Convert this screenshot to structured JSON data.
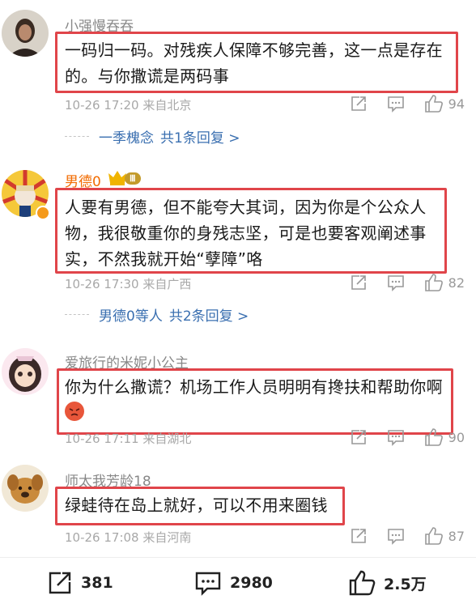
{
  "comments": [
    {
      "username": "小强慢吞吞",
      "text": "一码归一码。对残疾人保障不够完善，这一点是存在的。与你撒谎是两码事",
      "meta": "10-26 17:20 来自北京",
      "likes": "94",
      "reply": {
        "names": "一季槐念",
        "count": "共1条回复 >"
      }
    },
    {
      "username": "男德0",
      "badge": "Ⅲ",
      "text": "人要有男德，但不能夸大其词，因为你是个公众人物，我很敬重你的身残志坚，可是也要客观阐述事实，不然我就开始“孽障”咯",
      "meta": "10-26 17:30 来自广西",
      "likes": "82",
      "reply": {
        "names": "男德0等人",
        "count": "共2条回复 >"
      }
    },
    {
      "username": "爱旅行的米妮小公主",
      "text": "你为什么撒谎？机场工作人员明明有搀扶和帮助你啊",
      "meta": "10-26 17:11 来自湖北",
      "likes": "90"
    },
    {
      "username": "师太我芳龄18",
      "text": "绿蛙待在岛上就好，可以不用来圈钱",
      "meta": "10-26 17:08 来自河南",
      "likes": "87"
    }
  ],
  "bottom_bar": {
    "shares": "381",
    "comments": "2980",
    "likes": "2.5万"
  },
  "colors": {
    "highlight_box": "#e0454a",
    "reply_link": "#3a6fb0",
    "vip_name": "#f26b00"
  }
}
